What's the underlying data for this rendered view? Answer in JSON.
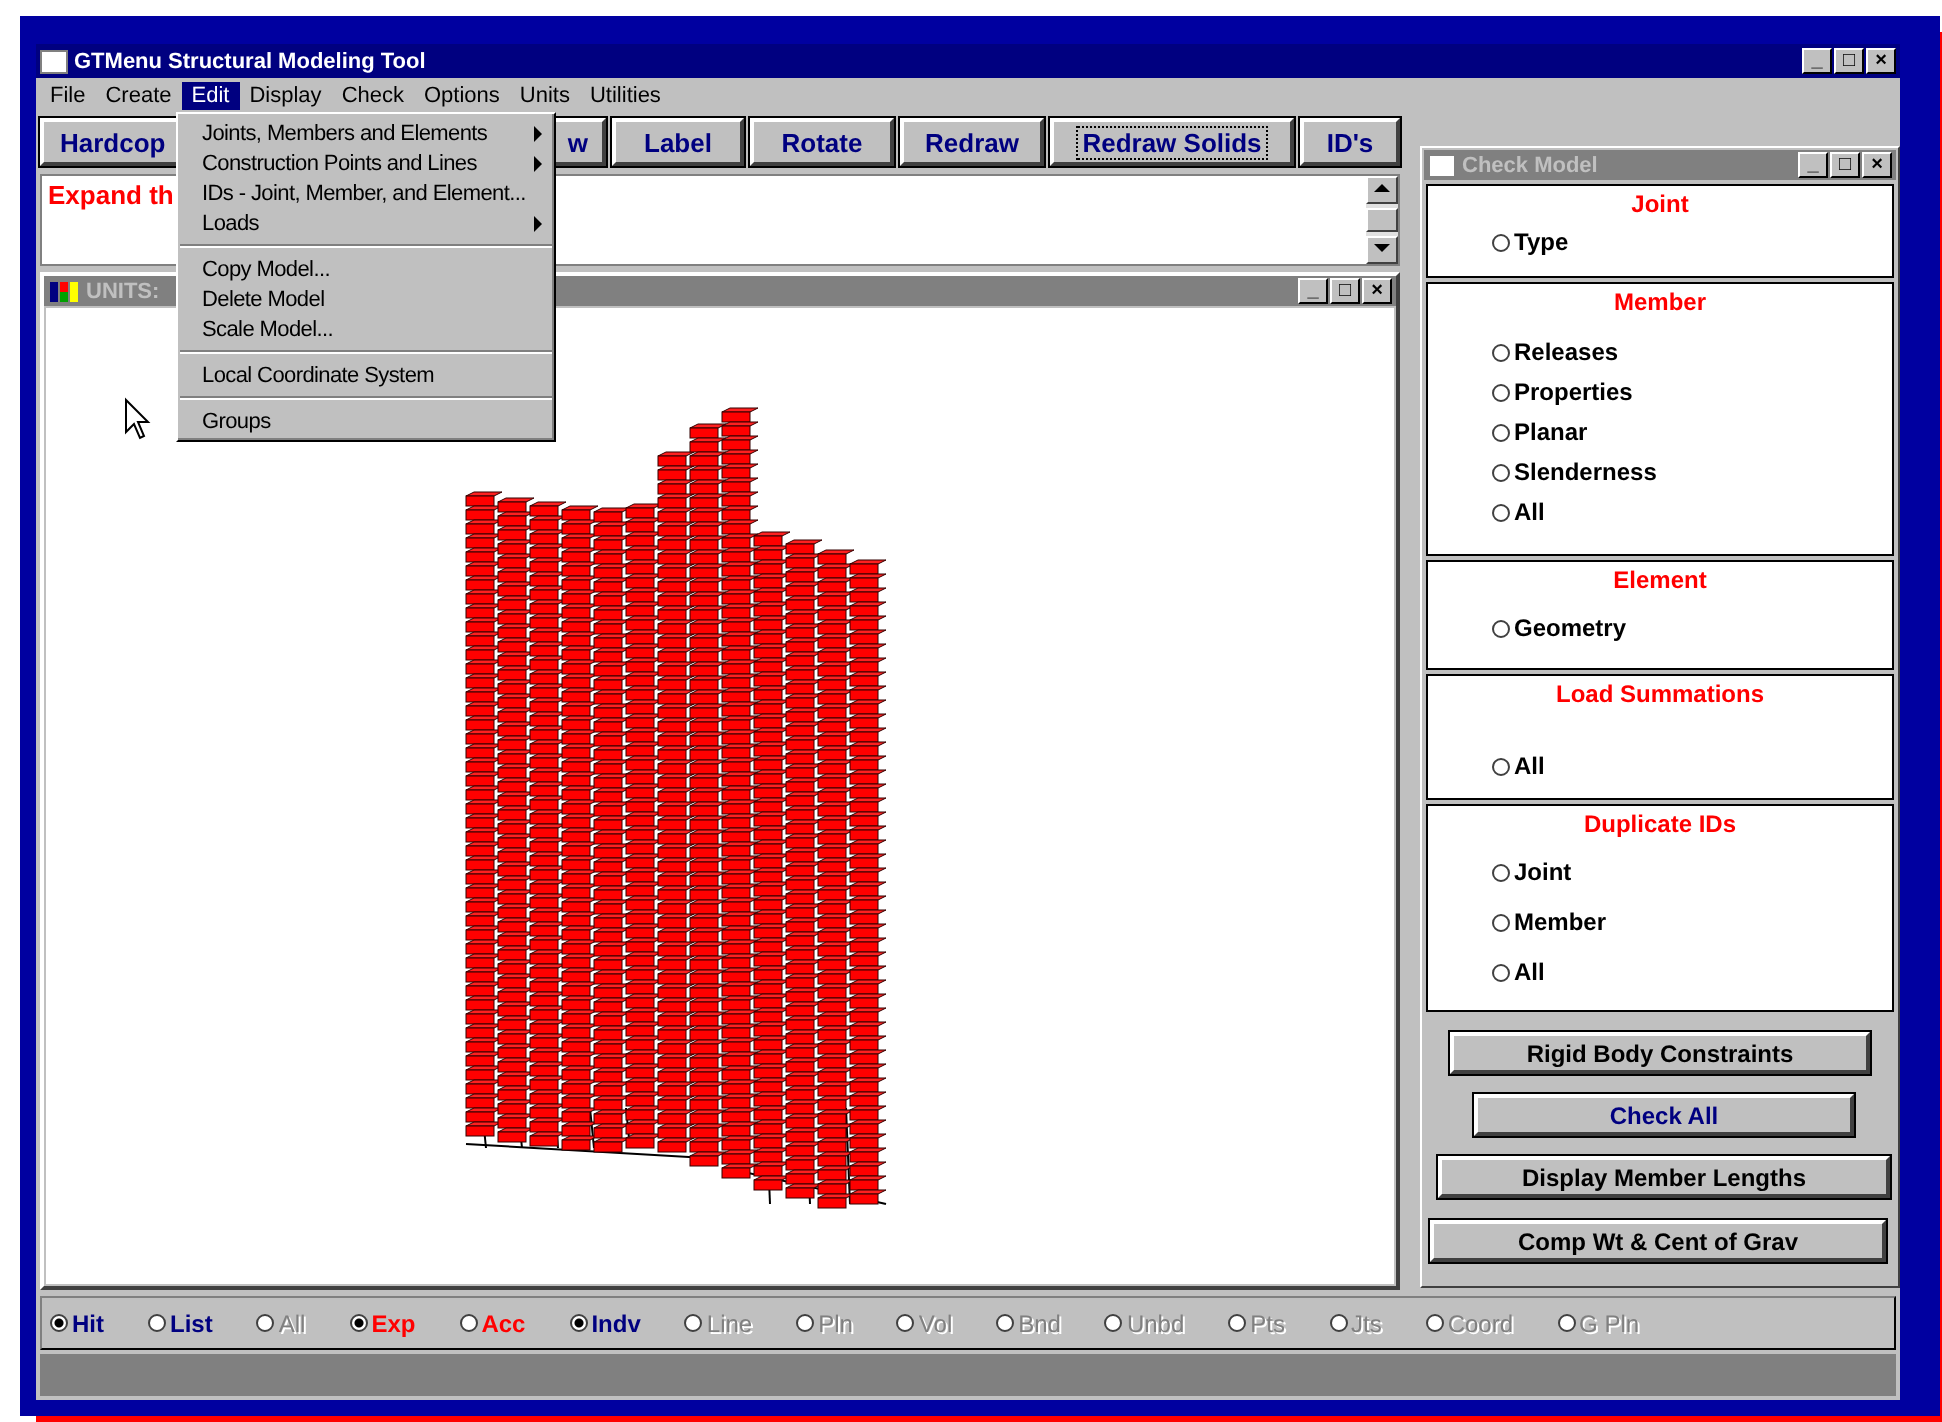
{
  "window": {
    "title": "GTMenu Structural Modeling Tool",
    "controls": [
      "_",
      "□",
      "×"
    ]
  },
  "menu_bar": [
    {
      "label": "File",
      "selected": false
    },
    {
      "label": "Create",
      "selected": false
    },
    {
      "label": "Edit",
      "selected": true
    },
    {
      "label": "Display",
      "selected": false
    },
    {
      "label": "Check",
      "selected": false
    },
    {
      "label": "Options",
      "selected": false
    },
    {
      "label": "Units",
      "selected": false
    },
    {
      "label": "Utilities",
      "selected": false
    }
  ],
  "open_menu": {
    "groups": [
      [
        {
          "label": "Joints, Members and Elements",
          "has_submenu": true
        },
        {
          "label": "Construction Points and Lines",
          "has_submenu": true
        },
        {
          "label": "IDs - Joint, Member, and Element...",
          "has_submenu": false
        },
        {
          "label": "Loads",
          "has_submenu": true
        }
      ],
      [
        {
          "label": "Copy Model...",
          "has_submenu": false
        },
        {
          "label": "Delete Model",
          "has_submenu": false
        },
        {
          "label": "Scale Model...",
          "has_submenu": false
        }
      ],
      [
        {
          "label": "Local Coordinate System",
          "has_submenu": false
        }
      ],
      [
        {
          "label": "Groups",
          "has_submenu": false
        }
      ]
    ]
  },
  "toolbar": [
    {
      "label": "Hardcop",
      "focused": false
    },
    {
      "label": "w",
      "focused": false
    },
    {
      "label": "Label",
      "focused": false
    },
    {
      "label": "Rotate",
      "focused": false
    },
    {
      "label": "Redraw",
      "focused": false
    },
    {
      "label": "Redraw Solids",
      "focused": true
    },
    {
      "label": "ID's",
      "focused": false
    }
  ],
  "message": {
    "text": "Expand th"
  },
  "units_window": {
    "title": "UNITS:",
    "controls": [
      "_",
      "□",
      "×"
    ]
  },
  "check_model": {
    "title": "Check Model",
    "controls": [
      "_",
      "□",
      "×"
    ],
    "sections": [
      {
        "heading": "Joint",
        "options": [
          {
            "label": "Type",
            "selected": false
          }
        ]
      },
      {
        "heading": "Member",
        "options": [
          {
            "label": "Releases",
            "selected": false
          },
          {
            "label": "Properties",
            "selected": false
          },
          {
            "label": "Planar",
            "selected": false
          },
          {
            "label": "Slenderness",
            "selected": false
          },
          {
            "label": "All",
            "selected": false
          }
        ]
      },
      {
        "heading": "Element",
        "options": [
          {
            "label": "Geometry",
            "selected": false
          }
        ]
      },
      {
        "heading": "Load Summations",
        "options": [
          {
            "label": "All",
            "selected": false
          }
        ]
      },
      {
        "heading": "Duplicate IDs",
        "options": [
          {
            "label": "Joint",
            "selected": false
          },
          {
            "label": "Member",
            "selected": false
          },
          {
            "label": "All",
            "selected": false
          }
        ]
      }
    ],
    "buttons": [
      {
        "label": "Rigid Body Constraints",
        "kind": "normal"
      },
      {
        "label": "Check All",
        "kind": "default"
      },
      {
        "label": "Display Member Lengths",
        "kind": "normal"
      },
      {
        "label": "Comp Wt & Cent of Grav",
        "kind": "normal"
      }
    ]
  },
  "options_bar": [
    {
      "label": "Hit",
      "selected": true,
      "disabled": false,
      "color": "#000080"
    },
    {
      "label": "List",
      "selected": false,
      "disabled": false,
      "color": "#000080"
    },
    {
      "label": "All",
      "selected": false,
      "disabled": true,
      "color": "#808080"
    },
    {
      "label": "Exp",
      "selected": true,
      "disabled": false,
      "color": "#ff0000"
    },
    {
      "label": "Acc",
      "selected": false,
      "disabled": false,
      "color": "#ff0000"
    },
    {
      "label": "Indv",
      "selected": true,
      "disabled": false,
      "color": "#000080"
    },
    {
      "label": "Line",
      "selected": false,
      "disabled": true,
      "color": "#808080"
    },
    {
      "label": "Pln",
      "selected": false,
      "disabled": true,
      "color": "#808080"
    },
    {
      "label": "Vol",
      "selected": false,
      "disabled": true,
      "color": "#808080"
    },
    {
      "label": "Bnd",
      "selected": false,
      "disabled": true,
      "color": "#808080"
    },
    {
      "label": "Unbd",
      "selected": false,
      "disabled": true,
      "color": "#808080"
    },
    {
      "label": "Pts",
      "selected": false,
      "disabled": true,
      "color": "#808080"
    },
    {
      "label": "Jts",
      "selected": false,
      "disabled": true,
      "color": "#808080"
    },
    {
      "label": "Coord",
      "selected": false,
      "disabled": true,
      "color": "#808080"
    },
    {
      "label": "G Pln",
      "selected": false,
      "disabled": true,
      "color": "#808080"
    }
  ]
}
